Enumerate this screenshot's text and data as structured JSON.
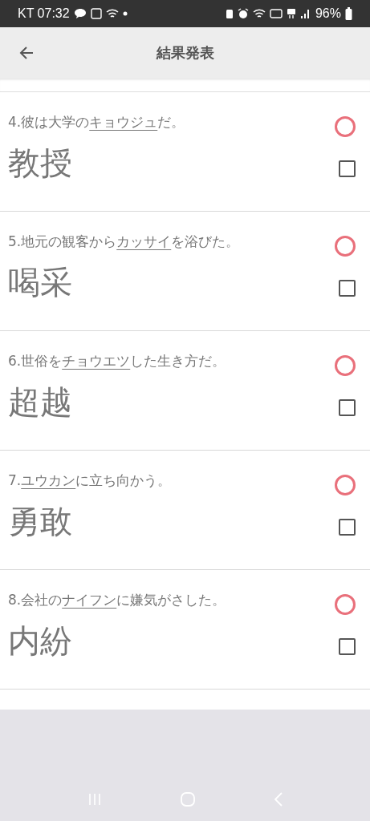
{
  "status_bar": {
    "carrier_time": "KT 07:32",
    "battery": "96%"
  },
  "header": {
    "title": "結果発表"
  },
  "questions": [
    {
      "number": "4.",
      "before": "彼は大学の",
      "underlined": "キョウジュ",
      "after": "だ。",
      "answer": "教授",
      "correct": true,
      "checked": false
    },
    {
      "number": "5.",
      "before": "地元の観客から",
      "underlined": "カッサイ",
      "after": "を浴びた。",
      "answer": "喝采",
      "correct": true,
      "checked": false
    },
    {
      "number": "6.",
      "before": "世俗を",
      "underlined": "チョウエツ",
      "after": "した生き方だ。",
      "answer": "超越",
      "correct": true,
      "checked": false
    },
    {
      "number": "7.",
      "underlined": "ユウカン",
      "after": "に立ち向かう。",
      "answer": "勇敢",
      "correct": true,
      "checked": false
    },
    {
      "number": "8.",
      "before": "会社の",
      "underlined": "ナイフン",
      "after": "に嫌気がさした。",
      "answer": "内紛",
      "correct": true,
      "checked": false
    }
  ]
}
